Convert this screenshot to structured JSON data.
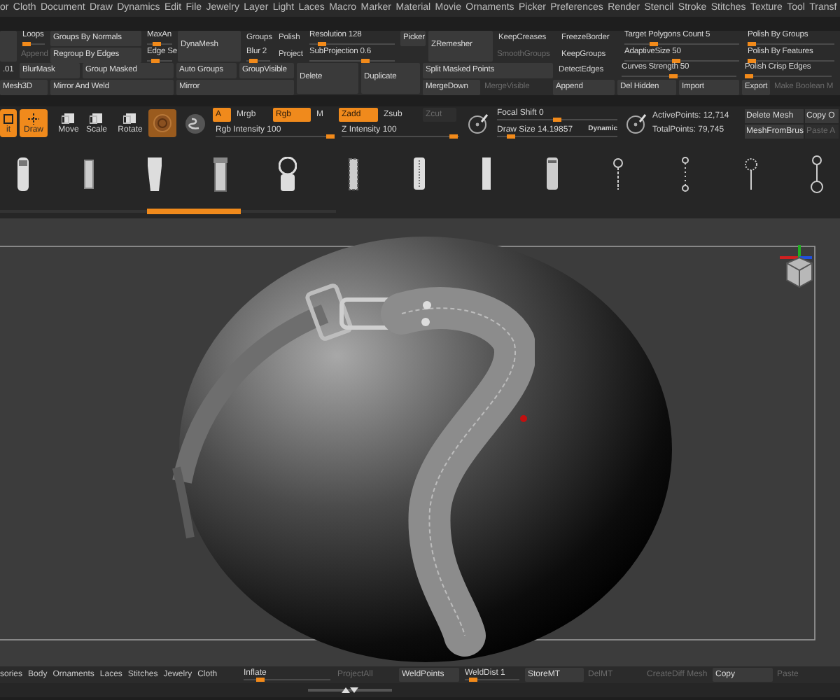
{
  "menu": [
    "or",
    "Cloth",
    "Document",
    "Draw",
    "Dynamics",
    "Edit",
    "File",
    "Jewelry",
    "Layer",
    "Light",
    "Laces",
    "Macro",
    "Marker",
    "Material",
    "Movie",
    "Ornaments",
    "Picker",
    "Preferences",
    "Render",
    "Stencil",
    "Stroke",
    "Stitches",
    "Texture",
    "Tool",
    "Transf"
  ],
  "panel_top": [
    [
      {
        "kind": "button"
      }
    ],
    [
      {
        "label": "Loops",
        "kind": "slider",
        "level": 0.2
      },
      {
        "label": "Append",
        "kind": "muted"
      }
    ],
    [
      {
        "label": "Groups By Normals",
        "kind": "button"
      },
      {
        "label": "Regroup By Edges",
        "kind": "button"
      }
    ],
    [
      {
        "label": "MaxAn",
        "kind": "slider",
        "level": 0.4
      },
      {
        "label": "Edge Se",
        "kind": "slider",
        "level": 0.35
      }
    ],
    [
      {
        "label": "DynaMesh",
        "kind": "button"
      }
    ],
    [
      {
        "label": "Groups",
        "kind": "text"
      },
      {
        "label": "Blur 2",
        "kind": "slider",
        "level": 0.3
      }
    ],
    [
      {
        "label": "Polish",
        "kind": "text"
      },
      {
        "label": "Project",
        "kind": "text"
      }
    ],
    [
      {
        "label": "Resolution 128",
        "kind": "slider",
        "level": 0.15
      },
      {
        "label": "SubProjection 0.6",
        "kind": "slider",
        "level": 0.65
      }
    ],
    [
      {
        "label": "Picker",
        "kind": "button"
      },
      {
        "kind": "blank"
      }
    ],
    [
      {
        "label": "ZRemesher",
        "kind": "button"
      }
    ],
    [
      {
        "label": "KeepCreases",
        "kind": "text"
      },
      {
        "label": "SmoothGroups",
        "kind": "muted"
      }
    ],
    [
      {
        "label": "FreezeBorder",
        "kind": "text"
      },
      {
        "label": "KeepGroups",
        "kind": "text"
      }
    ],
    [
      {
        "label": "Target Polygons Count 5",
        "kind": "slider",
        "level": 0.25
      },
      {
        "label": "AdaptiveSize 50",
        "kind": "slider",
        "level": 0.45
      }
    ],
    [
      {
        "label": "Polish By Groups",
        "kind": "slider",
        "level": 0.05
      },
      {
        "label": "Polish By Features",
        "kind": "slider",
        "level": 0.05
      }
    ]
  ],
  "panel_bottom": {
    "left_rows": [
      [
        {
          "label": ".01",
          "kind": "text"
        },
        {
          "label": "BlurMask",
          "kind": "button"
        },
        {
          "label": "Group Masked",
          "kind": "button"
        },
        {
          "label": "Auto Groups",
          "kind": "button"
        },
        {
          "label": "GroupVisible",
          "kind": "button"
        }
      ],
      [
        {
          "label": "Mesh3D",
          "kind": "button"
        },
        {
          "label": "Mirror And Weld",
          "kind": "button"
        },
        {
          "label": "Mirror",
          "kind": "button"
        }
      ]
    ],
    "tall": [
      {
        "label": "Delete",
        "kind": "button"
      },
      {
        "label": "Duplicate",
        "kind": "button"
      }
    ],
    "right_rows": [
      [
        {
          "label": "Split Masked Points",
          "kind": "button"
        },
        {
          "label": "DetectEdges",
          "kind": "text"
        },
        {
          "label": "Curves Strength 50",
          "kind": "slider",
          "level": 0.45
        },
        {
          "label": "Polish Crisp Edges",
          "kind": "slider",
          "level": 0.05
        }
      ],
      [
        {
          "label": "MergeDown",
          "kind": "button"
        },
        {
          "label": "MergeVisible",
          "kind": "muted"
        },
        {
          "label": "Append",
          "kind": "button"
        },
        {
          "label": "Del Hidden",
          "kind": "button"
        },
        {
          "label": "Import",
          "kind": "button"
        },
        {
          "label": "Export",
          "kind": "button"
        },
        {
          "label": "Make Boolean M",
          "kind": "muted"
        }
      ]
    ]
  },
  "toolbar": {
    "modes": [
      {
        "label": "it",
        "selected": true
      },
      {
        "label": "Draw",
        "selected": true
      },
      {
        "label": "Move",
        "selected": false
      },
      {
        "label": "Scale",
        "selected": false
      },
      {
        "label": "Rotate",
        "selected": false
      }
    ],
    "rgb_toggles": [
      {
        "label": "A",
        "selected": true
      },
      {
        "label": "Mrgb",
        "selected": false
      },
      {
        "label": "Rgb",
        "selected": true
      },
      {
        "label": "M",
        "selected": false
      }
    ],
    "rgb_intensity": {
      "label": "Rgb Intensity 100",
      "level": 0.98
    },
    "z_toggles": [
      {
        "label": "Zadd",
        "selected": true,
        "disabled": false
      },
      {
        "label": "Zsub",
        "selected": false,
        "disabled": false
      },
      {
        "label": "Zcut",
        "selected": false,
        "disabled": true
      }
    ],
    "z_intensity": {
      "label": "Z Intensity 100",
      "level": 0.95
    },
    "focal_shift": {
      "label": "Focal Shift 0",
      "level": 0.5
    },
    "draw_size": {
      "label": "Draw Size 14.19857",
      "level": 0.12
    },
    "dynamic": "Dynamic",
    "active_points": "ActivePoints: 12,714",
    "total_points": "TotalPoints: 79,745",
    "mesh_buttons": [
      {
        "label": "Delete Mesh",
        "disabled": false
      },
      {
        "label": "Copy O",
        "disabled": false
      },
      {
        "label": "MeshFromBrus",
        "disabled": false
      },
      {
        "label": "Paste A",
        "disabled": true
      }
    ]
  },
  "bottom_tabs": [
    "sories",
    "Body",
    "Ornaments",
    "Laces",
    "Stitches",
    "Jewelry",
    "Cloth"
  ],
  "bottom_controls": [
    {
      "label": "Inflate",
      "kind": "slider",
      "level": 0.2
    },
    {
      "label": "ProjectAll",
      "kind": "muted"
    },
    {
      "label": "WeldPoints",
      "kind": "button"
    },
    {
      "label": "WeldDist 1",
      "kind": "slider",
      "level": 0.15
    },
    {
      "label": "StoreMT",
      "kind": "button"
    },
    {
      "label": "DelMT",
      "kind": "muted"
    },
    {
      "label": "CreateDiff Mesh",
      "kind": "muted"
    },
    {
      "label": "Copy",
      "kind": "button"
    },
    {
      "label": "Paste",
      "kind": "muted"
    }
  ]
}
